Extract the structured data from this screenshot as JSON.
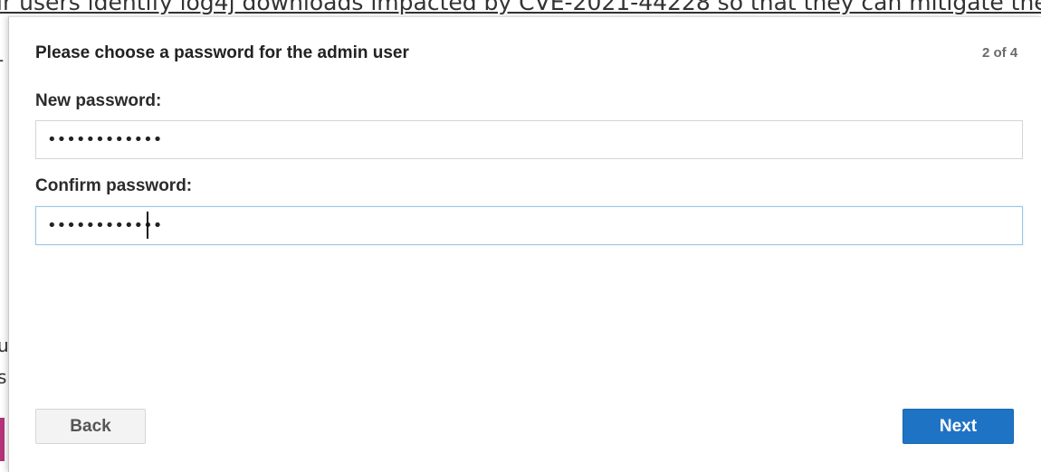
{
  "background": {
    "top_text": "ir users identify log4j downloads impacted by CVE-2021-44228 so that they can mitigate the",
    "side_letters": [
      "-",
      "u",
      "s"
    ]
  },
  "dialog": {
    "title": "Please choose a password for the admin user",
    "step_indicator": "2 of 4",
    "new_password": {
      "label": "New password:",
      "value": "••••••••••••"
    },
    "confirm_password": {
      "label": "Confirm password:",
      "value": "••••••••••••"
    },
    "back_label": "Back",
    "next_label": "Next"
  },
  "colors": {
    "accent": "#1f73c4",
    "backdrop_accent": "#b5337a",
    "focus_border": "#9cc7e4"
  }
}
